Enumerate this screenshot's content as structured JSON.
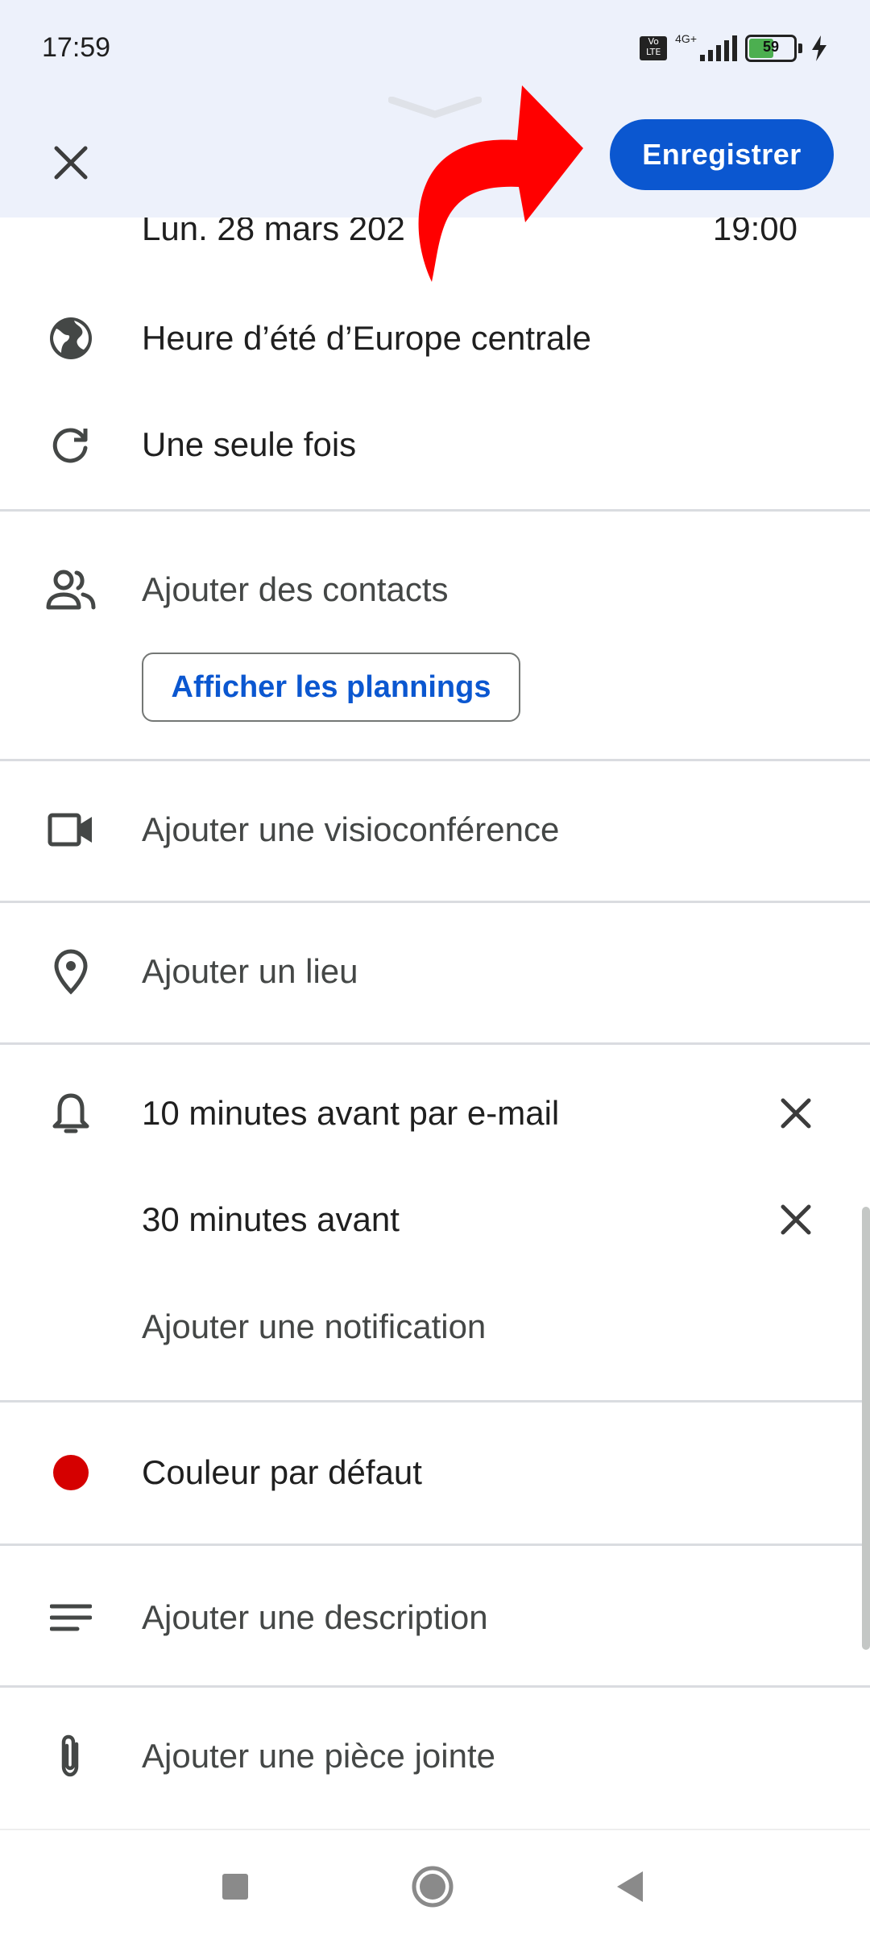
{
  "status_bar": {
    "time": "17:59",
    "volte_label": "Vo LTE",
    "network": "4G+",
    "battery_level": "59",
    "battery_percent": 59
  },
  "header": {
    "close_icon": "close-icon",
    "save_label": "Enregistrer",
    "accent_color": "#0b57d0"
  },
  "event": {
    "date": "Lun. 28 mars 202",
    "time": "19:00",
    "timezone": "Heure d’été d’Europe centrale",
    "repeat": "Une seule fois"
  },
  "contacts": {
    "label": "Ajouter des contacts",
    "schedules_button": "Afficher les plannings"
  },
  "video": {
    "label": "Ajouter une visioconférence"
  },
  "location": {
    "label": "Ajouter un lieu"
  },
  "notifications": {
    "items": [
      {
        "label": "10 minutes avant par e-mail"
      },
      {
        "label": "30 minutes avant"
      }
    ],
    "add_label": "Ajouter une notification"
  },
  "color": {
    "label": "Couleur par défaut",
    "value": "#d50000"
  },
  "description": {
    "label": "Ajouter une description"
  },
  "attachment": {
    "label": "Ajouter une pièce jointe"
  },
  "navigation": {
    "recents": "square-icon",
    "home": "circle-icon",
    "back": "triangle-back-icon"
  },
  "annotation_color": "#ff0000"
}
